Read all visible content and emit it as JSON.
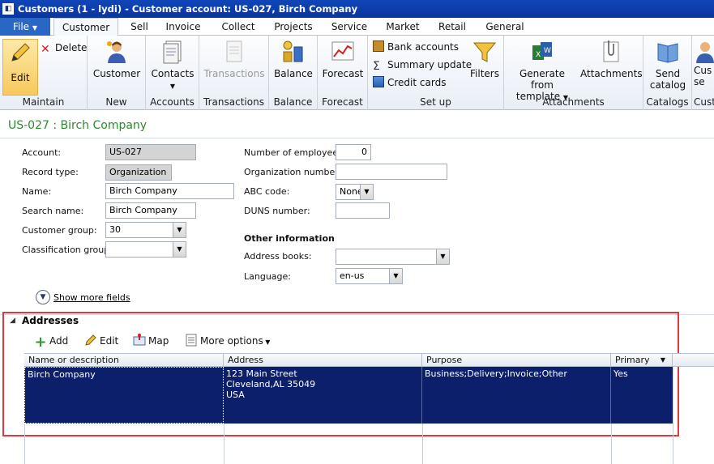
{
  "window": {
    "title": "Customers (1 - lydi) - Customer account: US-027, Birch Company"
  },
  "tabs": [
    {
      "label": "File"
    },
    {
      "label": "Customer"
    },
    {
      "label": "Sell"
    },
    {
      "label": "Invoice"
    },
    {
      "label": "Collect"
    },
    {
      "label": "Projects"
    },
    {
      "label": "Service"
    },
    {
      "label": "Market"
    },
    {
      "label": "Retail"
    },
    {
      "label": "General"
    }
  ],
  "ribbon": {
    "maintain": {
      "label": "Maintain",
      "edit": "Edit",
      "delete": "Delete"
    },
    "new": {
      "label": "New",
      "customer": "Customer"
    },
    "accounts": {
      "label": "Accounts",
      "contacts": "Contacts"
    },
    "transactions": {
      "label": "Transactions",
      "transactions": "Transactions"
    },
    "balance": {
      "label": "Balance",
      "balance": "Balance"
    },
    "forecast": {
      "label": "Forecast",
      "forecast": "Forecast"
    },
    "setup": {
      "label": "Set up",
      "bank_accounts": "Bank accounts",
      "summary_update": "Summary update",
      "credit_cards": "Credit cards",
      "filters": "Filters"
    },
    "attachments": {
      "label": "Attachments",
      "generate_from": "Generate from",
      "template": "template",
      "attachments": "Attachments"
    },
    "catalogs": {
      "label": "Catalogs",
      "send": "Send",
      "catalog": "catalog"
    },
    "customer_more": {
      "label": "Cust",
      "line1": "Cus",
      "line2": "se"
    }
  },
  "record": {
    "header": "US-027 : Birch Company"
  },
  "form": {
    "account": {
      "label": "Account:",
      "value": "US-027"
    },
    "record_type": {
      "label": "Record type:",
      "value": "Organization"
    },
    "name": {
      "label": "Name:",
      "value": "Birch Company"
    },
    "search_name": {
      "label": "Search name:",
      "value": "Birch Company"
    },
    "customer_group": {
      "label": "Customer group:",
      "value": "30"
    },
    "classification_group": {
      "label": "Classification group:",
      "value": ""
    },
    "num_employees": {
      "label": "Number of employees:",
      "value": "0"
    },
    "org_number": {
      "label": "Organization number:",
      "value": ""
    },
    "abc_code": {
      "label": "ABC code:",
      "value": "None"
    },
    "duns": {
      "label": "DUNS number:",
      "value": ""
    },
    "other_info": "Other information",
    "address_books": {
      "label": "Address books:",
      "value": ""
    },
    "language": {
      "label": "Language:",
      "value": "en-us"
    },
    "show_more": "Show more fields"
  },
  "addresses": {
    "title": "Addresses",
    "toolbar": {
      "add": "Add",
      "edit": "Edit",
      "map": "Map",
      "more": "More options"
    },
    "columns": [
      "Name or description",
      "Address",
      "Purpose",
      "Primary"
    ],
    "rows": [
      {
        "name": "Birch Company",
        "address1": "123 Main Street",
        "address2": "Cleveland,AL 35049",
        "address3": "USA",
        "purpose": "Business;Delivery;Invoice;Other",
        "primary": "Yes"
      }
    ]
  },
  "colors": {
    "accent": "#2a66c3",
    "selection": "#0c1f6b",
    "highlight": "#e0383c",
    "record_header": "#2d8a2d"
  }
}
